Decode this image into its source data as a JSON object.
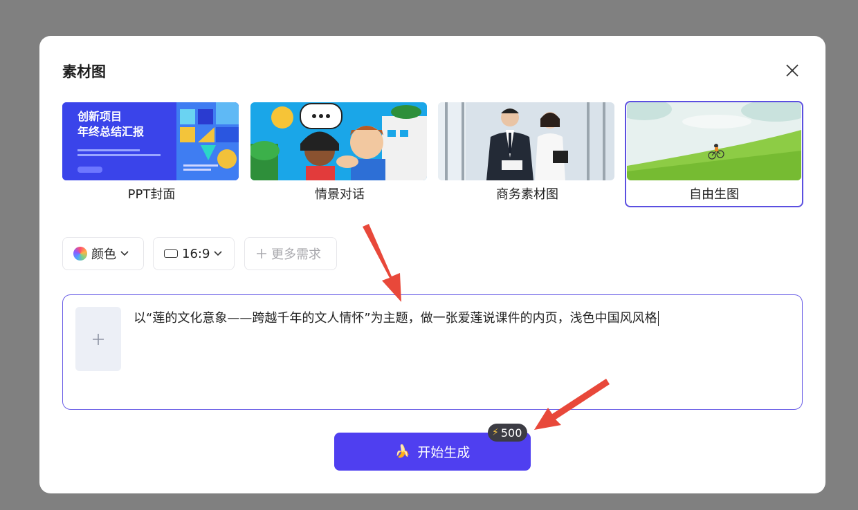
{
  "dialog": {
    "title": "素材图"
  },
  "templates": [
    {
      "label": "PPT封面",
      "thumb_title_1": "创新项目",
      "thumb_title_2": "年终总结汇报",
      "selected": false
    },
    {
      "label": "情景对话",
      "selected": false
    },
    {
      "label": "商务素材图",
      "selected": false
    },
    {
      "label": "自由生图",
      "selected": true
    }
  ],
  "options": {
    "color_label": "颜色",
    "ratio_label": "16:9",
    "more_label": "更多需求"
  },
  "prompt": {
    "text": "以“莲的文化意象——跨越千年的文人情怀”为主题，做一张爱莲说课件的内页，浅色中国风风格"
  },
  "generate": {
    "label": "开始生成",
    "cost": "500"
  },
  "colors": {
    "accent": "#4f3ff0",
    "selected_border": "#5b4fe0",
    "annotation_arrow": "#e8483a"
  },
  "icons": [
    "close-icon",
    "color-palette-icon",
    "chevron-down-icon",
    "aspect-ratio-icon",
    "plus-icon",
    "banana-icon",
    "lightning-icon"
  ]
}
